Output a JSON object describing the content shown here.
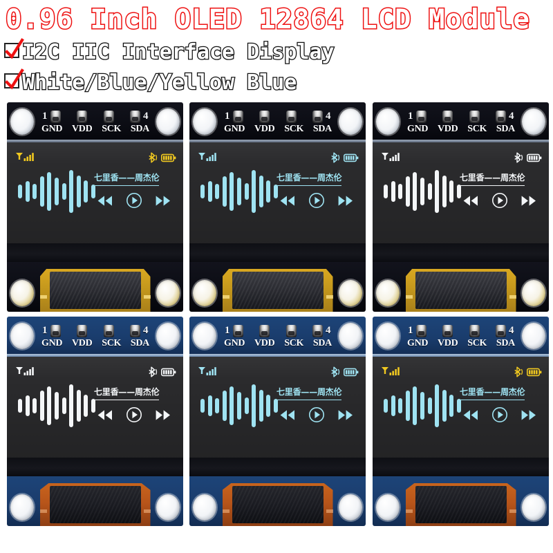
{
  "header": {
    "title": "0.96 Inch OLED 12864 LCD Module",
    "title_color": "#ee1111",
    "bullets": [
      {
        "text": "I2C IIC Interface Display",
        "checked": true
      },
      {
        "text": "White/Blue/Yellow Blue",
        "checked": true
      }
    ]
  },
  "pcb": {
    "pin_numbers": {
      "first": "1",
      "last": "4"
    },
    "pin_labels": [
      "GND",
      "VDD",
      "SCK",
      "SDA"
    ],
    "colors": {
      "dark_board": "#0b0c13",
      "blue_board": "#1a3c6c",
      "gold_fpc": "#c79a1d",
      "orange_fpc": "#b8551a"
    }
  },
  "display": {
    "song_title": "七里香——周杰伦",
    "icons": {
      "signal": "signal-bars-icon",
      "bluetooth": "bluetooth-icon",
      "battery": "battery-icon",
      "prev": "previous-track-icon",
      "play": "play-button-icon",
      "next": "next-track-icon"
    },
    "waveform": [
      20,
      30,
      22,
      44,
      56,
      40,
      24,
      62,
      46,
      32,
      20
    ],
    "theme_colors": {
      "white": "#f4f6f8",
      "blue": "#9fe3f2",
      "yellow": "#f0c820"
    }
  },
  "modules": [
    {
      "id": "module-1",
      "board": "dark",
      "status_theme": "yellow",
      "content_theme": "blue",
      "variant": "Yellow Blue"
    },
    {
      "id": "module-2",
      "board": "dark",
      "status_theme": "blue",
      "content_theme": "blue",
      "variant": "Blue"
    },
    {
      "id": "module-3",
      "board": "dark",
      "status_theme": "white",
      "content_theme": "white",
      "variant": "White"
    },
    {
      "id": "module-4",
      "board": "blue",
      "status_theme": "white",
      "content_theme": "white",
      "variant": "White"
    },
    {
      "id": "module-5",
      "board": "blue",
      "status_theme": "blue",
      "content_theme": "blue",
      "variant": "Blue"
    },
    {
      "id": "module-6",
      "board": "blue",
      "status_theme": "yellow",
      "content_theme": "blue",
      "variant": "Yellow Blue"
    }
  ]
}
